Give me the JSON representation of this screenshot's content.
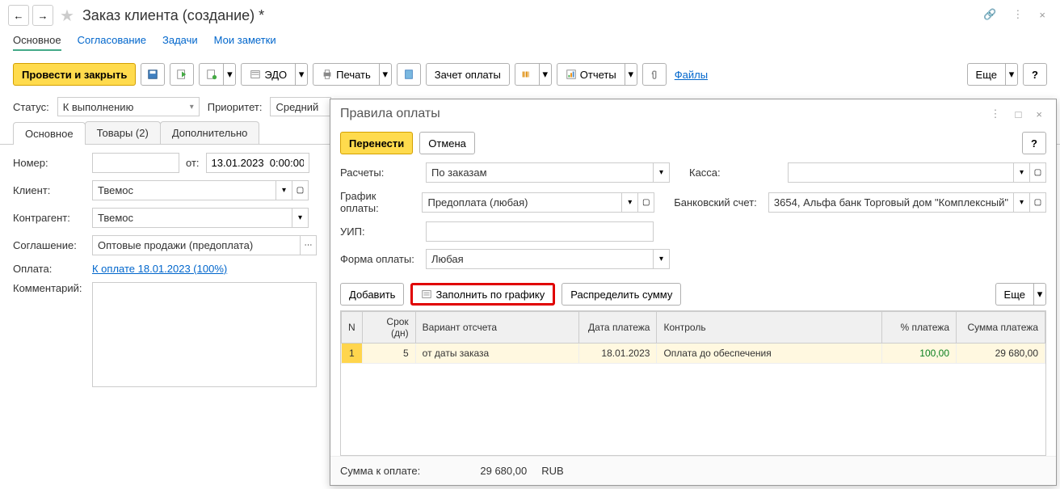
{
  "header": {
    "title": "Заказ клиента (создание) *"
  },
  "navTabs": {
    "main": "Основное",
    "approval": "Согласование",
    "tasks": "Задачи",
    "notes": "Мои заметки"
  },
  "toolbar": {
    "post_close": "Провести и закрыть",
    "edo": "ЭДО",
    "print": "Печать",
    "offset": "Зачет оплаты",
    "reports": "Отчеты",
    "files": "Файлы",
    "more": "Еще",
    "help": "?"
  },
  "status": {
    "status_label": "Статус:",
    "status_value": "К выполнению",
    "priority_label": "Приоритет:",
    "priority_value": "Средний"
  },
  "subTabs": {
    "main": "Основное",
    "goods": "Товары (2)",
    "extra": "Дополнительно"
  },
  "form": {
    "number_label": "Номер:",
    "from_label": "от:",
    "date_value": "13.01.2023  0:00:00",
    "client_label": "Клиент:",
    "client_value": "Твемос",
    "contragent_label": "Контрагент:",
    "contragent_value": "Твемос",
    "agreement_label": "Соглашение:",
    "agreement_value": "Оптовые продажи (предоплата)",
    "payment_label": "Оплата:",
    "payment_link": "К оплате 18.01.2023 (100%)",
    "comment_label": "Комментарий:"
  },
  "popup": {
    "title": "Правила оплаты",
    "transfer": "Перенести",
    "cancel": "Отмена",
    "help": "?",
    "calc_label": "Расчеты:",
    "calc_value": "По заказам",
    "kassa_label": "Касса:",
    "schedule_label": "График оплаты:",
    "schedule_value": "Предоплата (любая)",
    "bank_label": "Банковский счет:",
    "bank_value": "3654, Альфа банк Торговый дом \"Комплексный\"",
    "uip_label": "УИП:",
    "form_label": "Форма оплаты:",
    "form_value": "Любая",
    "add": "Добавить",
    "fill_schedule": "Заполнить по графику",
    "distribute": "Распределить сумму",
    "more": "Еще",
    "table": {
      "col_n": "N",
      "col_term": "Срок (дн)",
      "col_variant": "Вариант отсчета",
      "col_date": "Дата платежа",
      "col_control": "Контроль",
      "col_percent": "% платежа",
      "col_sum": "Сумма платежа",
      "rows": [
        {
          "n": "1",
          "term": "5",
          "variant": "от даты заказа",
          "date": "18.01.2023",
          "control": "Оплата до обеспечения",
          "percent": "100,00",
          "sum": "29 680,00"
        }
      ]
    },
    "footer": {
      "label": "Сумма к оплате:",
      "value": "29 680,00",
      "currency": "RUB"
    }
  }
}
